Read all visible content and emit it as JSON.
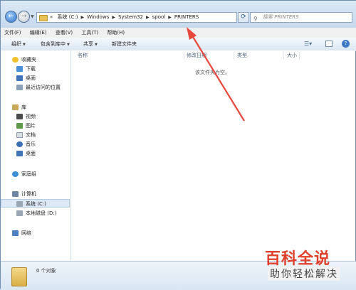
{
  "address": {
    "crumbs": [
      "系统 (C:)",
      "Windows",
      "System32",
      "spool",
      "PRINTERS"
    ],
    "chevrons": "«",
    "search_placeholder": "搜索 PRINTERS"
  },
  "menu": [
    "文件(F)",
    "编辑(E)",
    "查看(V)",
    "工具(T)",
    "帮助(H)"
  ],
  "commands": {
    "organize": "组织",
    "include_in_library": "包含到库中",
    "share": "共享",
    "new_folder": "新建文件夹"
  },
  "nav": {
    "favorites": "收藏夹",
    "downloads": "下载",
    "desktop": "桌面",
    "recent": "最近访问的位置",
    "libraries": "库",
    "videos": "视频",
    "pictures": "图片",
    "documents": "文档",
    "music": "音乐",
    "lib_desktop": "桌面",
    "homegroup": "家庭组",
    "computer": "计算机",
    "drive_c": "系统 (C:)",
    "drive_d": "本地磁盘 (D:)",
    "network": "网络"
  },
  "columns": [
    "名称",
    "修改日期",
    "类型",
    "大小"
  ],
  "empty_message": "该文件夹为空。",
  "status": {
    "item_count": "0 个对象"
  },
  "watermark": {
    "line1": "百科全说",
    "line2": "助你轻松解决"
  },
  "colors": {
    "accent": "#3b79c4",
    "arrow": "#e8473b",
    "watermark": "#e0402a"
  }
}
